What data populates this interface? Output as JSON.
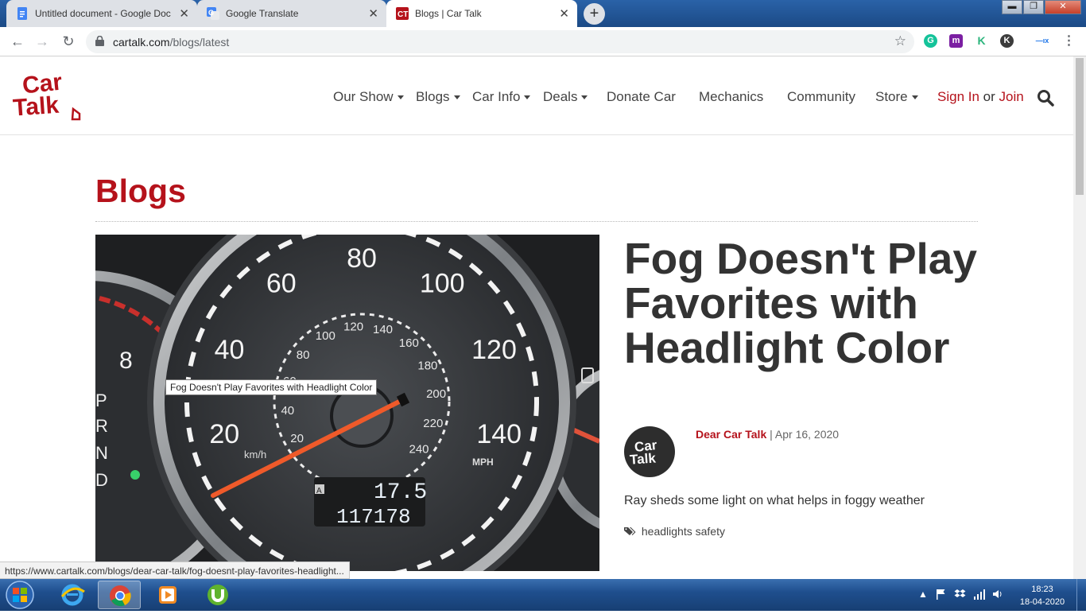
{
  "browser": {
    "tabs": [
      {
        "title": "Untitled document - Google Doc",
        "icon": "google-docs-icon",
        "active": false
      },
      {
        "title": "Google Translate",
        "icon": "google-translate-icon",
        "active": false
      },
      {
        "title": "Blogs | Car Talk",
        "icon": "cartalk-favicon",
        "active": true
      }
    ],
    "url_host": "cartalk.com",
    "url_path": "/blogs/latest",
    "window_controls": {
      "minimize": "▬",
      "maximize": "❐",
      "close": "✕"
    }
  },
  "site": {
    "logo_line1": "Car",
    "logo_line2": "Talk",
    "nav": [
      {
        "label": "Our Show",
        "dropdown": true
      },
      {
        "label": "Blogs",
        "dropdown": true
      },
      {
        "label": "Car Info",
        "dropdown": true
      },
      {
        "label": "Deals",
        "dropdown": true
      },
      {
        "label": "Donate Car",
        "dropdown": false
      },
      {
        "label": "Mechanics",
        "dropdown": false
      },
      {
        "label": "Community",
        "dropdown": false
      },
      {
        "label": "Store",
        "dropdown": true
      }
    ],
    "sign_in": "Sign In",
    "or": "or",
    "join": "Join",
    "brand_color": "#b5121b"
  },
  "main": {
    "page_title": "Blogs",
    "featured": {
      "headline": "Fog Doesn't Play Favorites with Headlight Color",
      "author": "Dear Car Talk",
      "separator": "|",
      "date": "Apr 16, 2020",
      "excerpt": "Ray sheds some light on what helps in foggy weather",
      "tags": "headlights safety",
      "image_tooltip": "Fog Doesn't Play Favorites with Headlight Color",
      "avatar_line1": "Car",
      "avatar_line2": "Talk"
    },
    "speedometer": {
      "mph_labels": [
        "20",
        "40",
        "60",
        "80",
        "100",
        "120",
        "140"
      ],
      "kmh_labels": [
        "20",
        "40",
        "60",
        "80",
        "100",
        "120",
        "140",
        "160",
        "180",
        "200",
        "220",
        "240"
      ],
      "unit_mph": "MPH",
      "unit_kmh": "km/h",
      "odo_trip": "17.5",
      "odo_total": "117178",
      "odo_mode": "A",
      "gauge_digit": "8",
      "gear_letters": [
        "P",
        "R",
        "N",
        "D"
      ]
    }
  },
  "status_bar_url": "https://www.cartalk.com/blogs/dear-car-talk/fog-doesnt-play-favorites-headlight...",
  "taskbar": {
    "clock_time": "18:23",
    "clock_date": "18-04-2020"
  }
}
